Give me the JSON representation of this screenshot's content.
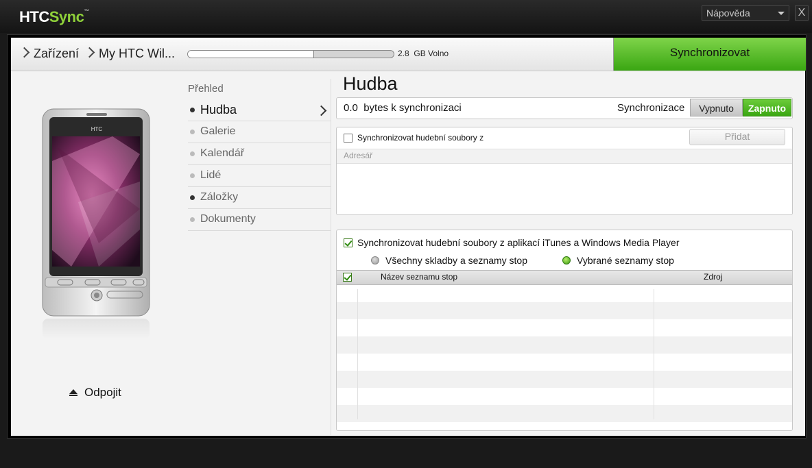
{
  "app": {
    "logo_htc": "HTC",
    "logo_sync": "Sync",
    "logo_tm": "™"
  },
  "topbar": {
    "help_label": "Nápověda",
    "close_label": "X"
  },
  "header": {
    "breadcrumb": [
      "Zařízení",
      "My HTC Wil..."
    ],
    "storage_fraction": 0.61,
    "free_value": "2.8",
    "free_unit": "GB Volno",
    "sync_button": "Synchronizovat"
  },
  "left": {
    "eject_label": "Odpojit"
  },
  "nav": {
    "title": "Přehled",
    "items": [
      {
        "label": "Hudba",
        "active": true,
        "dot": "dark"
      },
      {
        "label": "Galerie",
        "active": false,
        "dot": "light"
      },
      {
        "label": "Kalendář",
        "active": false,
        "dot": "light"
      },
      {
        "label": "Lidé",
        "active": false,
        "dot": "light"
      },
      {
        "label": "Záložky",
        "active": false,
        "dot": "dark"
      },
      {
        "label": "Dokumenty",
        "active": false,
        "dot": "light"
      }
    ]
  },
  "main": {
    "title": "Hudba",
    "bytes_value": "0.0",
    "bytes_label": "bytes k synchronizaci",
    "sync_label": "Synchronizace",
    "toggle_off": "Vypnuto",
    "toggle_on": "Zapnuto",
    "folder_sync": {
      "label": "Synchronizovat hudební soubory z",
      "checked": false,
      "add_button": "Přidat",
      "column_header": "Adresář"
    },
    "itunes_sync": {
      "label": "Synchronizovat hudební soubory z aplikací iTunes a Windows Media Player",
      "checked": true,
      "radio_all": "Všechny skladby a seznamy stop",
      "radio_selected": "Vybrané seznamy stop",
      "selected_option": "Vybrané seznamy stop",
      "col_name": "Název seznamu stop",
      "col_source": "Zdroj"
    }
  },
  "colors": {
    "accent_green": "#3aa612",
    "dark_bg": "#1a1a1a"
  }
}
